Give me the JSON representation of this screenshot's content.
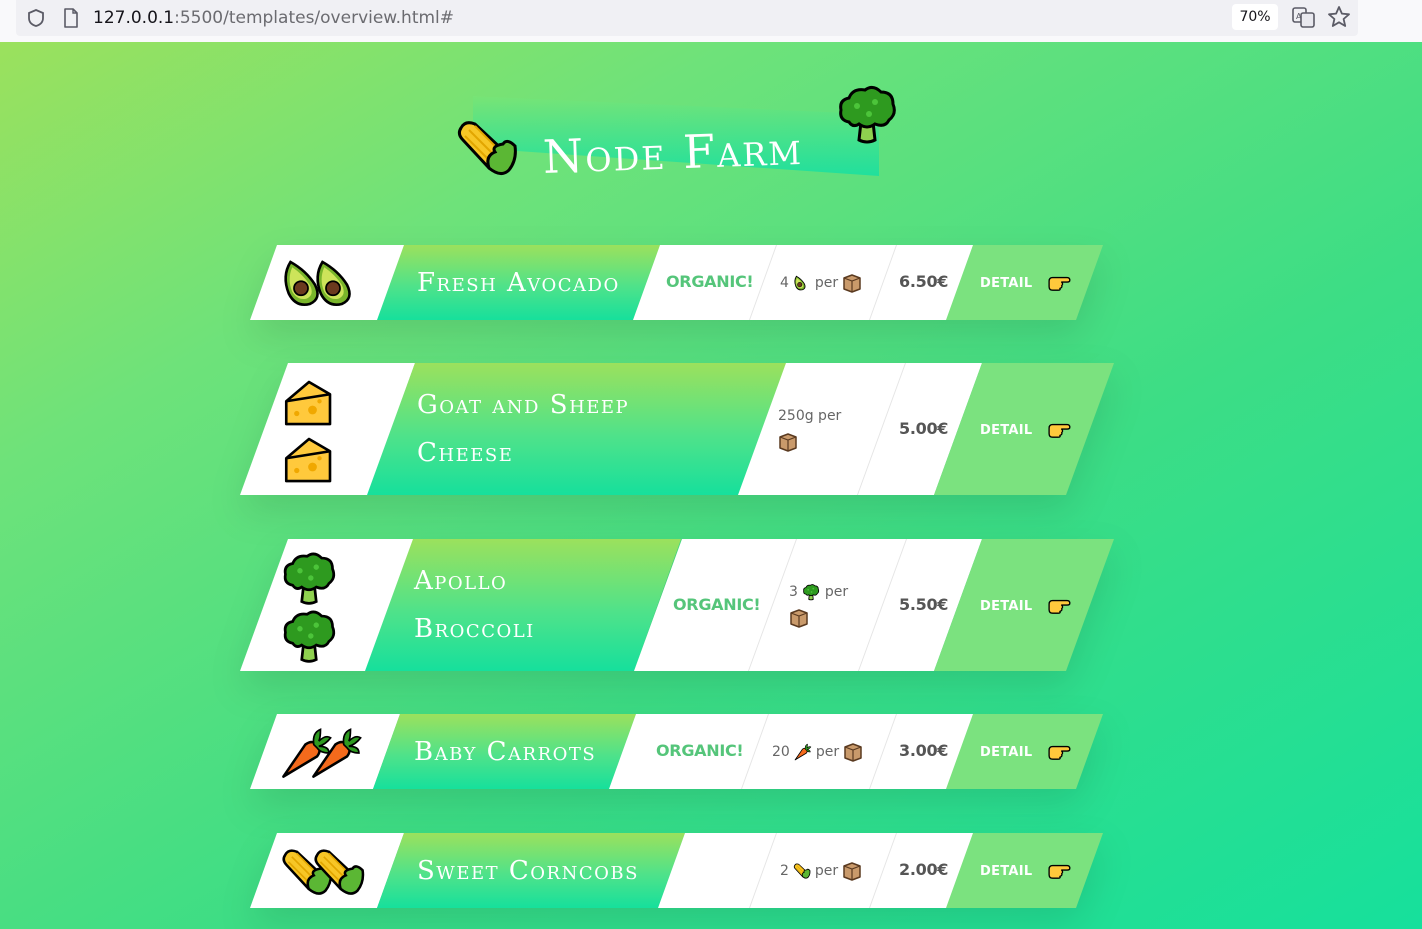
{
  "browser": {
    "url_host": "127.0.0.1",
    "url_rest": ":5500/templates/overview.html#",
    "zoom": "70%"
  },
  "hero": {
    "title": "Node Farm",
    "left_emoji": "corn-icon",
    "right_emoji": "broccoli-icon"
  },
  "products": [
    {
      "name": "Fresh Avocado",
      "emoji": "avocado",
      "organic": "ORGANIC!",
      "qty_count": "4",
      "qty_per": "per",
      "price": "6.50€",
      "detail": "DETAIL"
    },
    {
      "name_line1": "Goat and Sheep",
      "name_line2": "Cheese",
      "emoji": "cheese",
      "organic": "",
      "qty_count": "250g per",
      "price": "5.00€",
      "detail": "DETAIL"
    },
    {
      "name_line1": "Apollo",
      "name_line2": "Broccoli",
      "emoji": "broccoli",
      "organic": "ORGANIC!",
      "qty_count": "3",
      "qty_per": "per",
      "price": "5.50€",
      "detail": "DETAIL"
    },
    {
      "name": "Baby Carrots",
      "emoji": "carrot",
      "organic": "ORGANIC!",
      "qty_count": "20",
      "qty_per": "per",
      "price": "3.00€",
      "detail": "DETAIL"
    },
    {
      "name": "Sweet Corncobs",
      "emoji": "corn",
      "organic": "",
      "qty_count": "2",
      "qty_per": "per",
      "price": "2.00€",
      "detail": "DETAIL"
    }
  ],
  "colors": {
    "organic_green": "#55c57a",
    "detail_bg": "#7be27f",
    "gradient_top": "#9be15d",
    "gradient_bottom": "#16e09c"
  }
}
